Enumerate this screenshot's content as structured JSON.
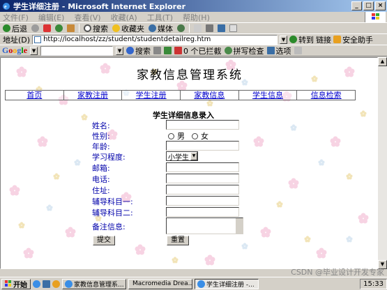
{
  "window": {
    "title": "学生详细注册 - Microsoft Internet Explorer"
  },
  "menu": [
    "文件(F)",
    "编辑(E)",
    "查看(V)",
    "收藏(A)",
    "工具(T)",
    "帮助(H)"
  ],
  "toolbar": {
    "back": "后退",
    "search": "搜索",
    "favorites": "收藏夹",
    "media": "媒体"
  },
  "address": {
    "label": "地址(D)",
    "url": "http://localhost/zz/student/studentdetailreg.htm",
    "go": "转到",
    "links": "链接",
    "helper": "安全助手"
  },
  "google": {
    "logo": "Google",
    "search": "搜索",
    "blocked": "0 个已拦截",
    "spell": "拼写检查",
    "options": "选项"
  },
  "page": {
    "title": "家教信息管理系统",
    "nav": [
      "首页",
      "家教注册",
      "学生注册",
      "家教信息",
      "学生信息",
      "信息检索"
    ],
    "form_title": "学生详细信息录入",
    "labels": {
      "name": "姓名:",
      "gender": "性别:",
      "age": "年龄:",
      "level": "学习程度:",
      "email": "邮箱:",
      "phone": "电话:",
      "address": "住址:",
      "subject1": "辅导科目一:",
      "subject2": "辅导科目二:",
      "remarks": "备注信息:"
    },
    "gender_male": "男",
    "gender_female": "女",
    "level_value": "小学生",
    "submit": "提交",
    "reset": "重置"
  },
  "taskbar": {
    "start": "开始",
    "tasks": [
      "家教信息管理系...",
      "Macromedia Drea...",
      "学生详细注册 -..."
    ],
    "clock": "15:33"
  },
  "watermark": "CSDN @毕业设计开发专家"
}
